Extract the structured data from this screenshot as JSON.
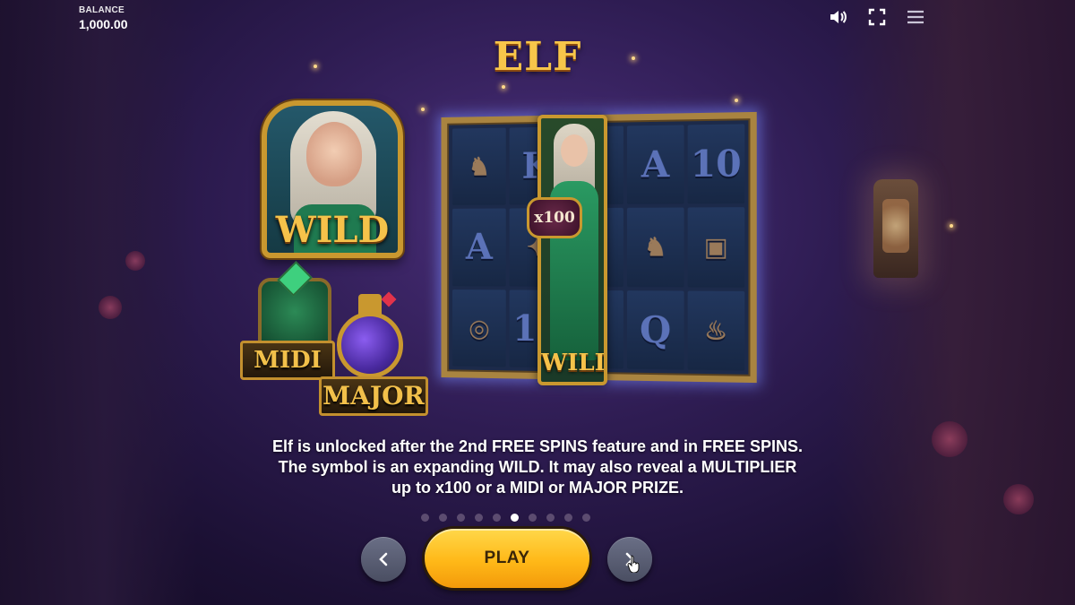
{
  "hud": {
    "balance_label": "BALANCE",
    "balance_value": "1,000.00",
    "icons": [
      "speaker-icon",
      "fullscreen-icon",
      "menu-icon"
    ]
  },
  "page": {
    "title": "ELF",
    "wild_label": "WILD",
    "midi_label": "MIDI",
    "major_label": "MAJOR",
    "multiplier_label": "x100",
    "reel_wild_label": "WILD",
    "reel_symbols": [
      "boots",
      "K",
      "A",
      "10",
      "A",
      "compass",
      "boots",
      "book",
      "ring",
      "10",
      "Q",
      "pipe"
    ]
  },
  "description": {
    "line1": "Elf is unlocked after the 2nd FREE SPINS feature and in FREE SPINS.",
    "line2": "The symbol is an expanding WILD. It may also reveal a MULTIPLIER",
    "line3": "up to x100 or a MIDI or MAJOR PRIZE."
  },
  "pager": {
    "total": 10,
    "active_index": 5
  },
  "controls": {
    "play_label": "PLAY",
    "prev_icon": "chevron-left-icon",
    "next_icon": "chevron-right-icon"
  },
  "colors": {
    "accent": "#f7c64a",
    "play": "#ffb818",
    "background": "#2e1c52"
  }
}
